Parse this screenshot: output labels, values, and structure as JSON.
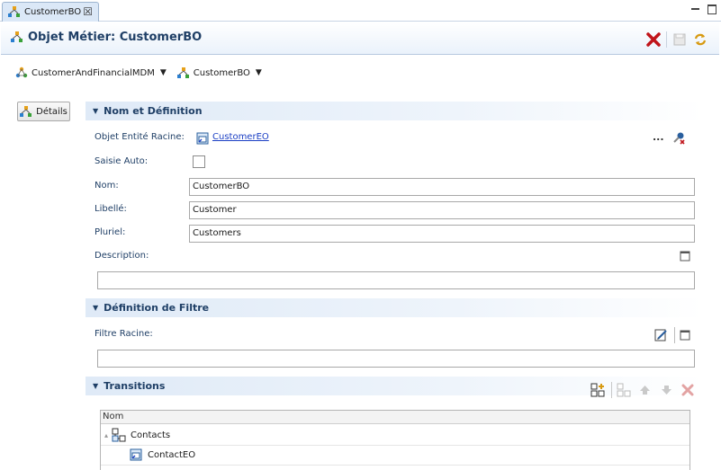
{
  "tab": {
    "label": "CustomerBO",
    "close": "☒"
  },
  "header": {
    "title": "Objet Métier: CustomerBO"
  },
  "breadcrumb": {
    "model": "CustomerAndFinancialMDM",
    "object": "CustomerBO"
  },
  "details_button": {
    "label": "Détails"
  },
  "sections": {
    "name_def": {
      "title": "Nom et Définition"
    },
    "filter": {
      "title": "Définition de Filtre"
    },
    "transitions": {
      "title": "Transitions"
    }
  },
  "form": {
    "root_entity_label": "Objet Entité Racine:",
    "root_entity_value": "CustomerEO",
    "auto_label": "Saisie Auto:",
    "name_label": "Nom:",
    "name_value": "CustomerBO",
    "libelle_label": "Libellé:",
    "libelle_value": "Customer",
    "pluriel_label": "Pluriel:",
    "pluriel_value": "Customers",
    "description_label": "Description:",
    "description_value": "",
    "filtre_label": "Filtre Racine:",
    "filtre_value": "",
    "ellipsis": "..."
  },
  "table": {
    "header": "Nom",
    "rows": [
      {
        "label": "Contacts",
        "expander": "▴"
      },
      {
        "label": "ContactEO"
      }
    ]
  },
  "colors": {
    "accent": "#1f3f66",
    "delete": "#c0141a",
    "link": "#1a3ec4"
  }
}
